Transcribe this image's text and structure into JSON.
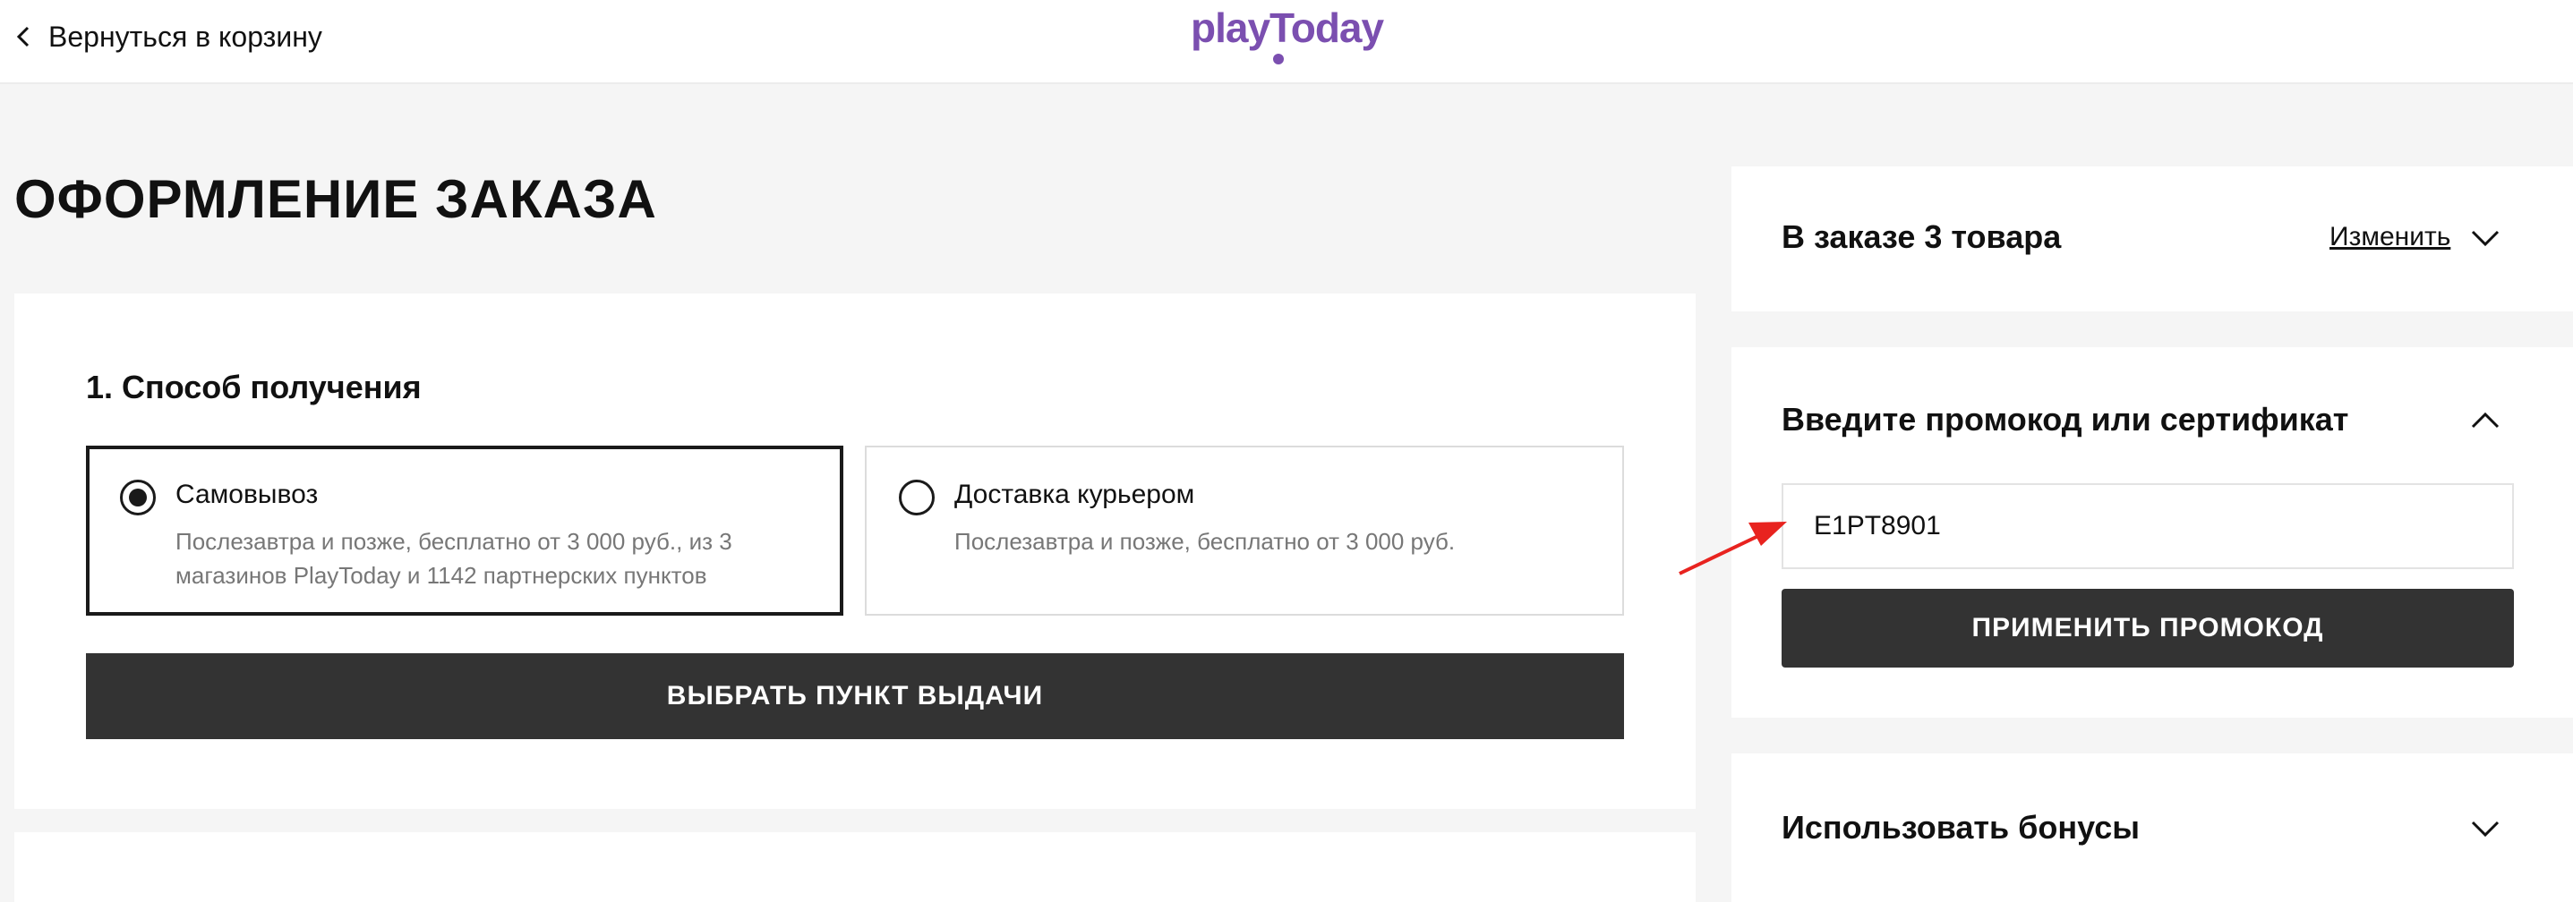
{
  "header": {
    "back_label": "Вернуться в корзину",
    "logo_text": "playToday"
  },
  "page": {
    "title": "ОФОРМЛЕНИЕ ЗАКАЗА"
  },
  "delivery": {
    "section_title": "1. Способ получения",
    "options": [
      {
        "title": "Самовывоз",
        "description": "Послезавтра и позже, бесплатно от 3 000 руб., из 3 магазинов PlayToday и 1142 партнерских пунктов",
        "selected": true
      },
      {
        "title": "Доставка курьером",
        "description": "Послезавтра и позже, бесплатно от 3 000 руб.",
        "selected": false
      }
    ],
    "pickup_button": "ВЫБРАТЬ ПУНКТ ВЫДАЧИ"
  },
  "summary": {
    "title": "В заказе 3 товара",
    "change_link": "Изменить"
  },
  "promo": {
    "title": "Введите промокод или сертификат",
    "code_value": "E1PT8901",
    "apply_button": "ПРИМЕНИТЬ ПРОМОКОД"
  },
  "bonus": {
    "title": "Использовать бонусы"
  },
  "colors": {
    "brand": "#7b4fb0",
    "dark_button": "#333333",
    "annotation_arrow": "#e8231f",
    "page_bg": "#f5f5f5"
  },
  "icons": {
    "back": "chevron-left-icon",
    "summary_toggle": "chevron-down-icon",
    "promo_toggle": "chevron-up-icon",
    "bonus_toggle": "chevron-down-icon",
    "annotation": "red-arrow-icon"
  }
}
